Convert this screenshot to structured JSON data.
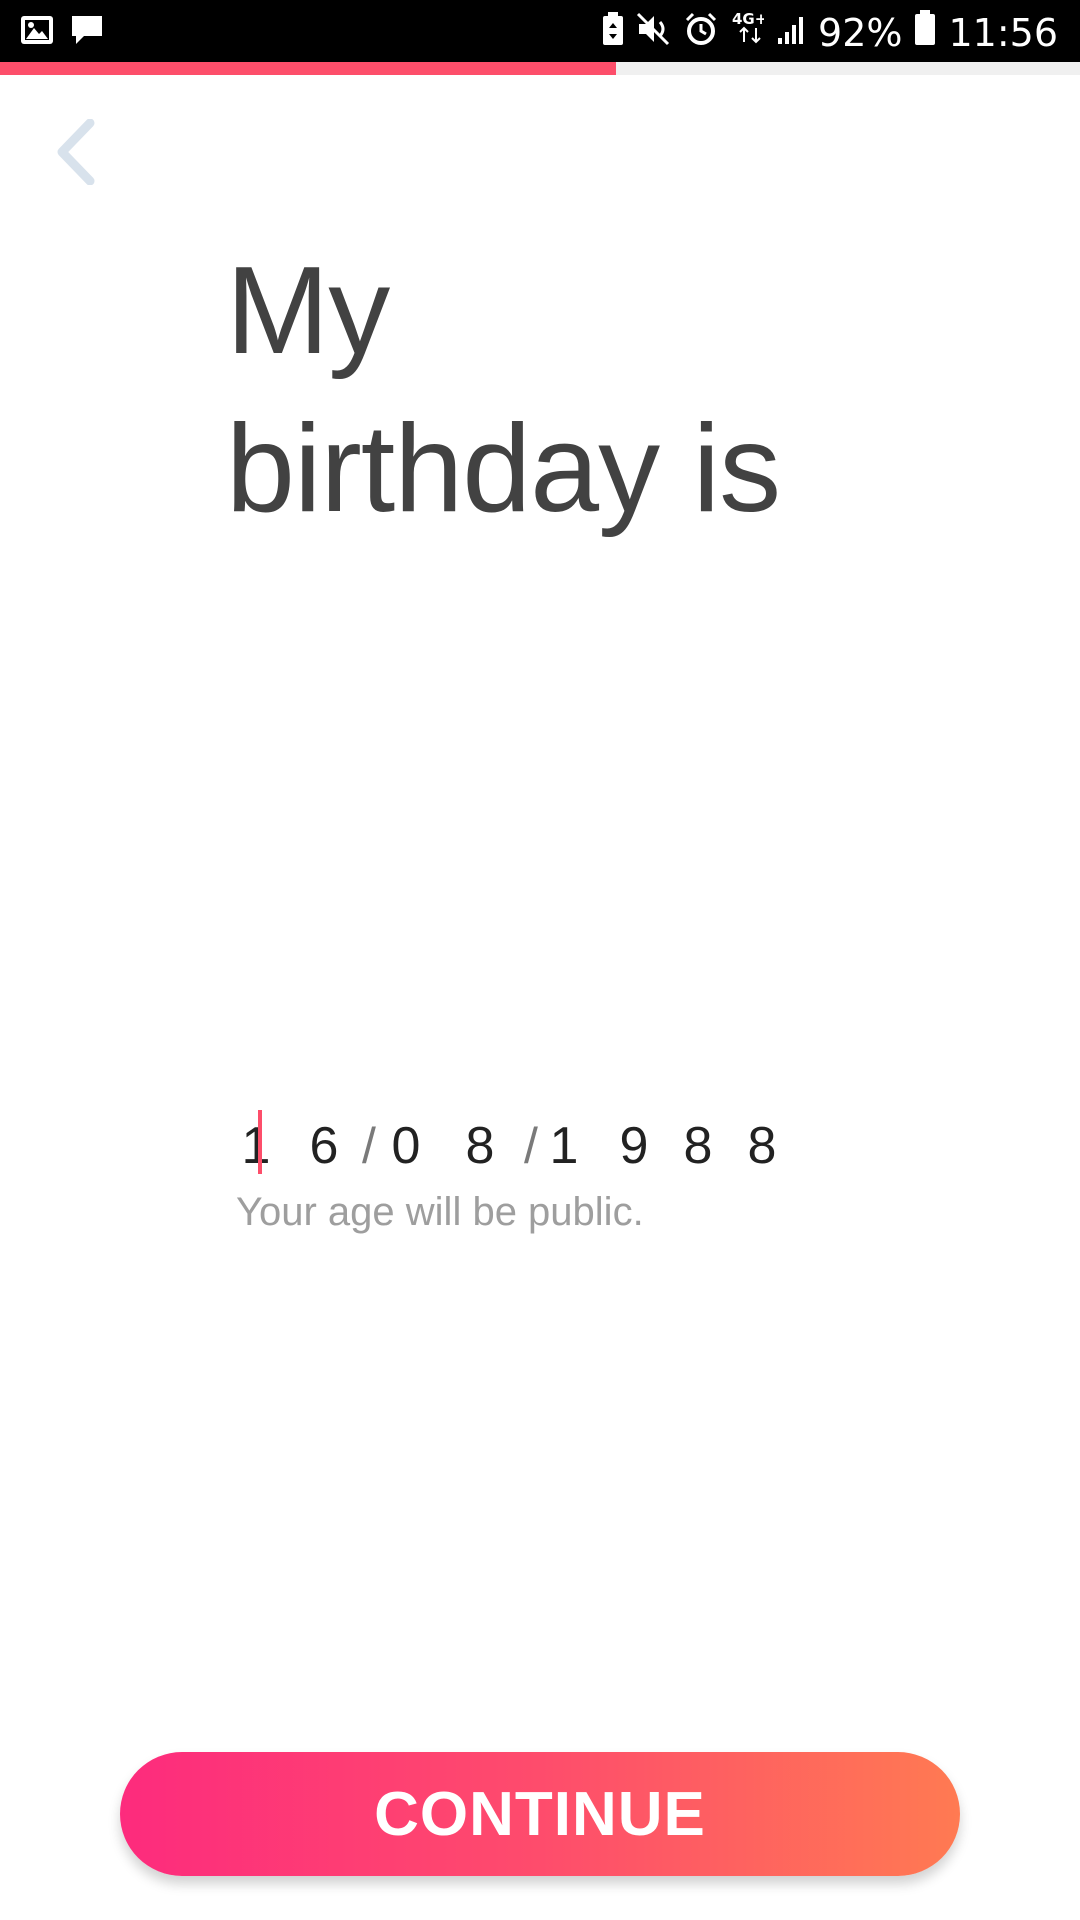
{
  "status_bar": {
    "battery_percent": "92%",
    "time": "11:56",
    "network": "4G+",
    "icons": [
      "gallery-icon",
      "message-icon",
      "battery-saver-icon",
      "mute-icon",
      "alarm-icon",
      "network-4g-icon",
      "signal-icon",
      "battery-icon"
    ]
  },
  "progress": {
    "fraction": 0.57,
    "color": "#fd4e6a"
  },
  "back": {
    "icon": "chevron-left-icon",
    "color": "#d8e2ec"
  },
  "title": {
    "line1": "My",
    "line2": "birthday is"
  },
  "birthday_input": {
    "day": [
      "1",
      "6"
    ],
    "month": [
      "0",
      "8"
    ],
    "year": [
      "1",
      "9",
      "8",
      "8"
    ],
    "separator": "/",
    "caret_color": "#fd4e6a"
  },
  "helper_text": "Your age will be public.",
  "continue_button": {
    "label": "CONTINUE",
    "gradient": [
      "#fd2b7d",
      "#fe4c6c",
      "#ff7a52"
    ]
  }
}
